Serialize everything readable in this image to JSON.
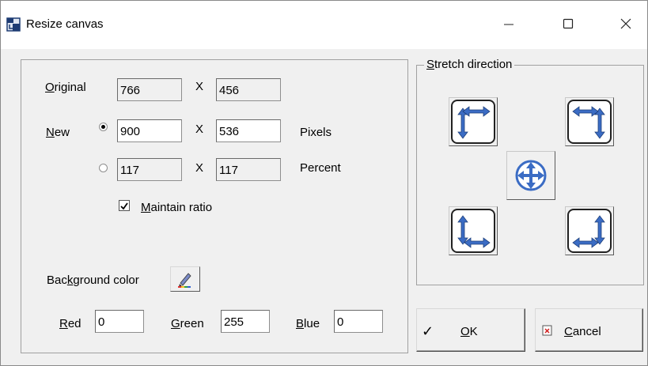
{
  "window": {
    "title": "Resize canvas",
    "controls": {
      "minimize": "—",
      "maximize": "☐",
      "close": "✕"
    }
  },
  "size": {
    "original_label_pre": "",
    "original_label_u": "O",
    "original_label_post": "riginal",
    "original_width": "766",
    "original_height": "456",
    "new_label_u": "N",
    "new_label_post": "ew",
    "new_width": "900",
    "new_height": "536",
    "percent_width": "117",
    "percent_height": "117",
    "x_sep": "X",
    "pixels_label": "Pixels",
    "percent_label": "Percent",
    "mode_selected": "pixels",
    "maintain_u": "M",
    "maintain_post": "aintain ratio",
    "maintain_checked": true
  },
  "background": {
    "label_pre": "Bac",
    "label_u": "k",
    "label_post": "ground color",
    "picker_icon": "color-picker-icon",
    "red_u": "R",
    "red_post": "ed",
    "red": "0",
    "green_u": "G",
    "green_post": "reen",
    "green": "255",
    "blue_u": "B",
    "blue_post": "lue",
    "blue": "0"
  },
  "stretch": {
    "label_u": "S",
    "label_post": "tretch direction",
    "buttons": [
      "top-left",
      "top-right",
      "center",
      "bottom-left",
      "bottom-right"
    ],
    "arrow_color": "#3b6cc4"
  },
  "actions": {
    "ok_mark": "✓",
    "ok_u": "O",
    "ok_post": "K",
    "cancel_u": "C",
    "cancel_post": "ancel"
  }
}
